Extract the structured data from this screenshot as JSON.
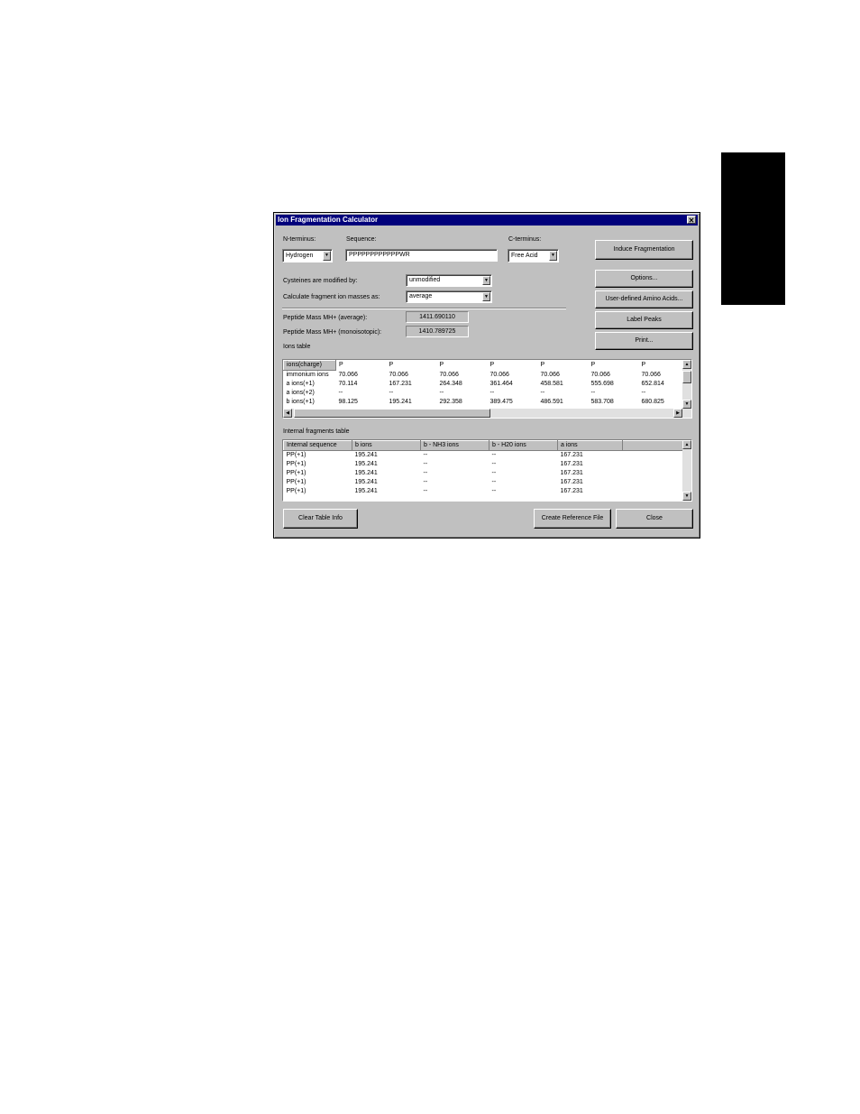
{
  "dialog": {
    "title": "Ion Fragmentation Calculator",
    "close_glyph": "✕"
  },
  "n_terminus": {
    "label": "N-terminus:",
    "value": "Hydrogen"
  },
  "sequence": {
    "label": "Sequence:",
    "value": "PPPPPPPPPPPPWR"
  },
  "c_terminus": {
    "label": "C-terminus:",
    "value": "Free Acid"
  },
  "cysteines": {
    "label": "Cysteines are modified by:",
    "value": "unmodified"
  },
  "fragment_masses": {
    "label": "Calculate fragment ion masses as:",
    "value": "average"
  },
  "mass_average": {
    "label": "Peptide Mass MH+ (average):",
    "value": "1411.690110"
  },
  "mass_mono": {
    "label": "Peptide Mass MH+ (monoisotopic):",
    "value": "1410.789725"
  },
  "buttons": {
    "induce": "Induce Fragmentation",
    "options": "Options...",
    "user_defined": "User-defined Amino Acids...",
    "label_peaks": "Label Peaks",
    "print": "Print...",
    "clear": "Clear Table Info",
    "create_ref": "Create Reference File",
    "close": "Close"
  },
  "ions_table": {
    "label": "Ions table",
    "headers": [
      "ions(charge)",
      "P",
      "P",
      "P",
      "P",
      "P",
      "P",
      "P"
    ],
    "rows": [
      [
        "immonium ions",
        "70.066",
        "70.066",
        "70.066",
        "70.066",
        "70.066",
        "70.066",
        "70.066"
      ],
      [
        "a ions(+1)",
        "70.114",
        "167.231",
        "264.348",
        "361.464",
        "458.581",
        "555.698",
        "652.814"
      ],
      [
        "a ions(+2)",
        "--",
        "--",
        "--",
        "--",
        "--",
        "--",
        "--"
      ],
      [
        "b ions(+1)",
        "98.125",
        "195.241",
        "292.358",
        "389.475",
        "486.591",
        "583.708",
        "680.825"
      ]
    ]
  },
  "internal_table": {
    "label": "Internal fragments table",
    "headers": [
      "Internal sequence",
      "b ions",
      "b - NH3 ions",
      "b - H20 ions",
      "a ions",
      ""
    ],
    "rows": [
      [
        "PP(+1)",
        "195.241",
        "--",
        "--",
        "167.231"
      ],
      [
        "PP(+1)",
        "195.241",
        "--",
        "--",
        "167.231"
      ],
      [
        "PP(+1)",
        "195.241",
        "--",
        "--",
        "167.231"
      ],
      [
        "PP(+1)",
        "195.241",
        "--",
        "--",
        "167.231"
      ],
      [
        "PP(+1)",
        "195.241",
        "--",
        "--",
        "167.231"
      ]
    ]
  },
  "glyphs": {
    "down": "▼",
    "up": "▲",
    "left": "◀",
    "right": "▶"
  }
}
